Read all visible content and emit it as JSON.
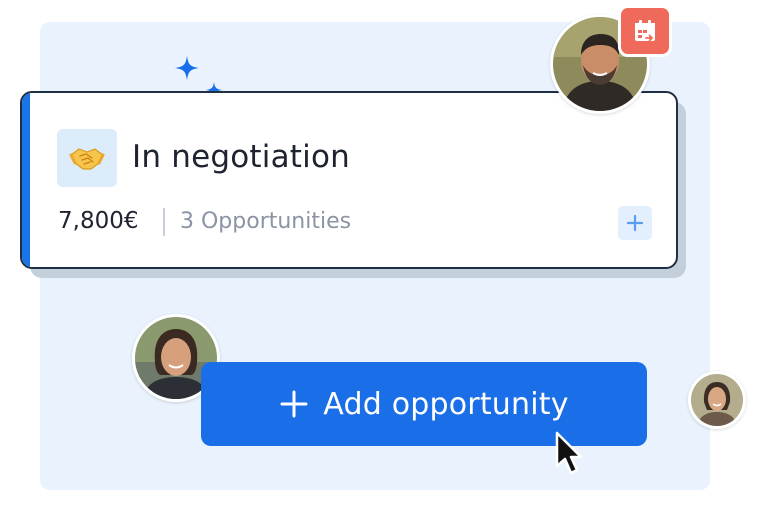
{
  "stage": {
    "emoji": "🤝",
    "title": "In negotiation",
    "amount": "7,800€",
    "count_label": "3 Opportunities",
    "add_icon": "plus-icon"
  },
  "actions": {
    "add_opportunity_label": "Add opportunity",
    "add_icon": "plus-icon"
  },
  "badges": {
    "calendar_icon": "calendar-arrow-icon"
  },
  "colors": {
    "accent": "#1a73e8",
    "button": "#1a6ee8",
    "panel_bg": "#eaf3fd",
    "calendar_badge": "#f06a5b"
  }
}
